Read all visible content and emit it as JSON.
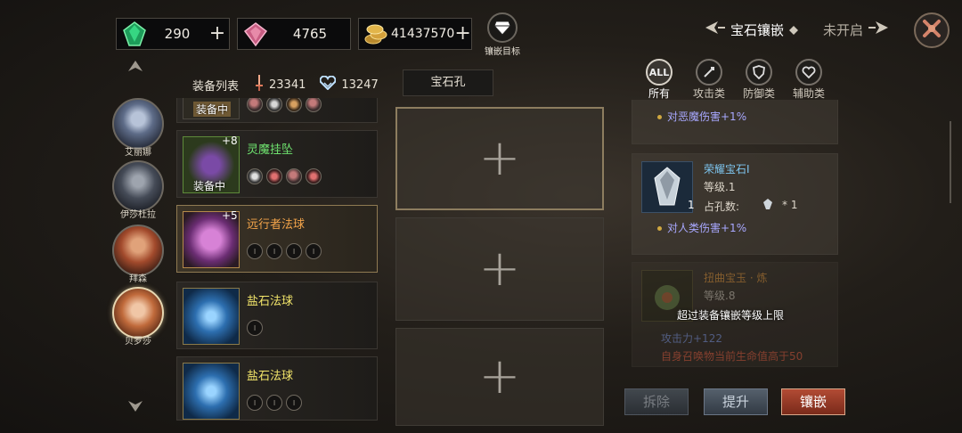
{
  "currency": {
    "emerald": {
      "value": "290",
      "icon": "green-gem-icon"
    },
    "ruby": {
      "value": "4765",
      "icon": "pink-gem-icon"
    },
    "gold": {
      "value": "41437570",
      "icon": "gold-coin-icon"
    }
  },
  "goal": {
    "label": "镶嵌目标"
  },
  "modes": {
    "active": "宝石镶嵌",
    "inactive": "未开启"
  },
  "heroes": [
    {
      "name": "艾丽娜"
    },
    {
      "name": "伊莎杜拉"
    },
    {
      "name": "拜森"
    },
    {
      "name": "贝罗莎"
    }
  ],
  "equipment": {
    "header": "装备列表",
    "attack": "23341",
    "defense": "13247",
    "items": [
      {
        "name": "",
        "level": "",
        "tag": "装备中",
        "sockets": 4
      },
      {
        "name": "灵魔挂坠",
        "level": "+8",
        "tag": "装备中",
        "sockets": 4
      },
      {
        "name": "远行者法球",
        "level": "+5",
        "tag": "",
        "sockets": 4
      },
      {
        "name": "盐石法球",
        "level": "",
        "tag": "",
        "sockets": 1
      },
      {
        "name": "盐石法球",
        "level": "",
        "tag": "",
        "sockets": 3
      }
    ]
  },
  "slots": {
    "tab": "宝石孔",
    "plus": "+"
  },
  "filters": [
    {
      "icon": "ALL",
      "label": "所有"
    },
    {
      "icon": "",
      "label": "攻击类"
    },
    {
      "icon": "",
      "label": "防御类"
    },
    {
      "icon": "",
      "label": "辅助类"
    }
  ],
  "gems": {
    "top_stat": "对恶魔伤害+1%",
    "card": {
      "name": "荣耀宝石Ⅰ",
      "level": "等级.1",
      "slots_label": "占孔数:",
      "slots_val": "* 1",
      "count": "1",
      "stat": "对人类伤害+1%"
    },
    "dim_card": {
      "name": "扭曲宝玉 · 炼",
      "level": "等级.8",
      "stat1": "攻击力+122",
      "stat2": "自身召唤物当前生命值高于50"
    },
    "warning": "超过装备镶嵌等级上限"
  },
  "buttons": {
    "dismantle": "拆除",
    "upgrade": "提升",
    "inlay": "镶嵌"
  }
}
